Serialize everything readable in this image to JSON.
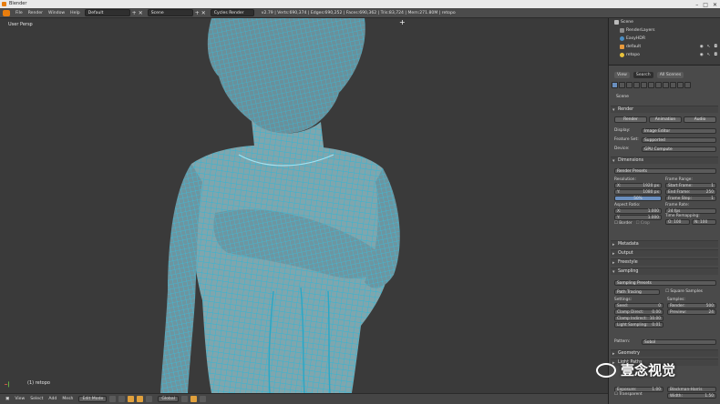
{
  "window": {
    "title": "Blender"
  },
  "infobar": {
    "menus": [
      "File",
      "Render",
      "Window",
      "Help"
    ],
    "layout": "Default",
    "scene": "Scene",
    "engine": "Cycles Render",
    "stats": "v2.79 | Verts:690,374 | Edges:690,252 | Faces:690,362 | Tris:83,724 | Mem:271.80M | retopo"
  },
  "viewport": {
    "label": "User Persp",
    "object_label": "(1) retopo"
  },
  "footer": {
    "items": [
      "View",
      "Select",
      "Add",
      "Mesh"
    ],
    "mode": "Edit Mode",
    "pivot": "Global"
  },
  "outliner": {
    "items": [
      {
        "label": "Scene",
        "icon": "scene-icon"
      },
      {
        "label": "RenderLayers",
        "icon": "render-layers-icon"
      },
      {
        "label": "EasyHDR",
        "icon": "world-icon"
      },
      {
        "label": "default",
        "icon": "object-icon"
      },
      {
        "label": "retopo",
        "icon": "mesh-icon"
      }
    ]
  },
  "properties": {
    "tabs": [
      "View",
      "Search",
      "All Scenes"
    ],
    "breadcrumb": "Scene",
    "render_panel": {
      "title": "Render",
      "buttons": [
        "Render",
        "Animation",
        "Audio"
      ],
      "display_label": "Display:",
      "display_value": "Image Editor",
      "feature_label": "Feature Set:",
      "feature_value": "Supported",
      "device_label": "Device:",
      "device_value": "GPU Compute"
    },
    "dimensions": {
      "title": "Dimensions",
      "presets": "Render Presets",
      "resolution_label": "Resolution:",
      "res_x": {
        "label": "X:",
        "value": "1920 px"
      },
      "res_y": {
        "label": "Y:",
        "value": "1080 px"
      },
      "res_pct": "50%",
      "aspect_label": "Aspect Ratio:",
      "aspect_x": {
        "label": "X:",
        "value": "1.000"
      },
      "aspect_y": {
        "label": "Y:",
        "value": "1.000"
      },
      "border_label": "Border",
      "crop_label": "Crop",
      "frame_range_label": "Frame Range:",
      "start": {
        "label": "Start Frame:",
        "value": "1"
      },
      "end": {
        "label": "End Frame:",
        "value": "250"
      },
      "step": {
        "label": "Frame Step:",
        "value": "1"
      },
      "frame_rate_label": "Frame Rate:",
      "frame_rate": "24 fps",
      "remap_label": "Time Remapping:",
      "remap_old": "O: 100",
      "remap_new": "N: 100"
    },
    "closed_panels": [
      "Metadata",
      "Output",
      "Freestyle",
      "Sampling"
    ],
    "sampling": {
      "presets": "Sampling Presets",
      "method": "Path Tracing",
      "square_label": "Square Samples",
      "settings_label": "Settings:",
      "samples_label": "Samples:",
      "seed": {
        "label": "Seed:",
        "value": "0"
      },
      "clamp_direct": {
        "label": "Clamp Direct:",
        "value": "0.00"
      },
      "clamp_indirect": {
        "label": "Clamp Indirect:",
        "value": "10.00"
      },
      "light_sampling": {
        "label": "Light Sampling:",
        "value": "0.01"
      },
      "render": {
        "label": "Render:",
        "value": "500"
      },
      "preview": {
        "label": "Preview:",
        "value": "24"
      },
      "pattern_label": "Pattern:",
      "pattern_value": "Sobol"
    },
    "more_panels": [
      "Geometry",
      "Light Paths"
    ],
    "bottom": {
      "transparent": "Transparent",
      "exposure": {
        "label": "Exposure:",
        "value": "1.00"
      },
      "filter": "Blackman-Harris",
      "width": {
        "label": "Width:",
        "value": "1.50"
      }
    }
  },
  "watermark": {
    "text": "壹念视觉"
  },
  "colors": {
    "wire": "#4fc4e0",
    "accent": "#e87d0d"
  }
}
